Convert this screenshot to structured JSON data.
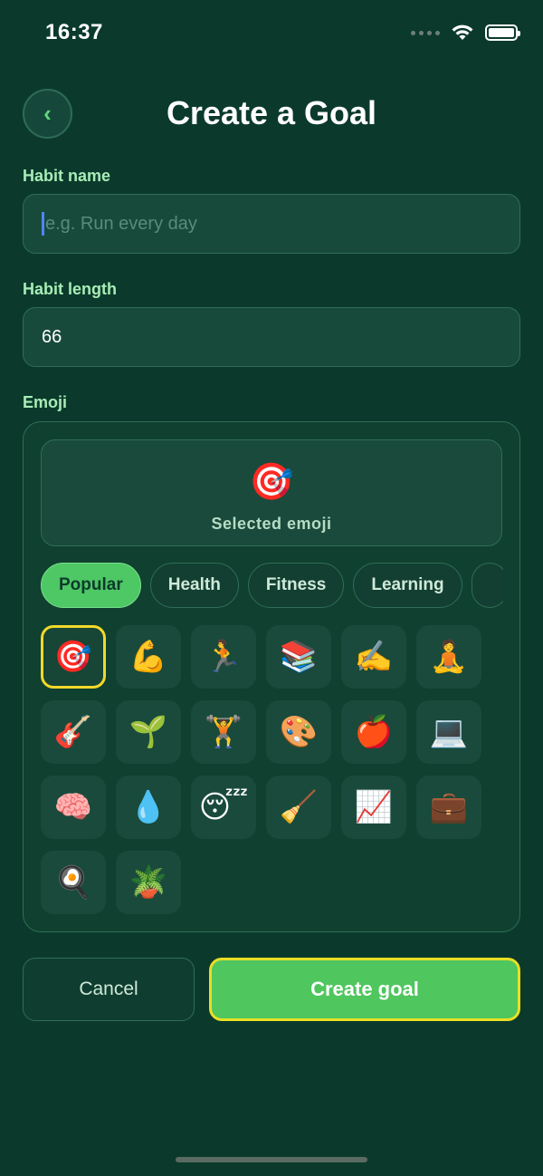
{
  "status_bar": {
    "time": "16:37"
  },
  "header": {
    "title": "Create a Goal",
    "back_glyph": "‹"
  },
  "habit_name": {
    "label": "Habit name",
    "placeholder": "e.g. Run every day",
    "value": ""
  },
  "habit_length": {
    "label": "Habit length",
    "value": "66"
  },
  "emoji": {
    "label": "Emoji",
    "selected_emoji": "🎯",
    "selected_label": "Selected emoji",
    "categories": [
      {
        "label": "Popular",
        "active": true
      },
      {
        "label": "Health",
        "active": false
      },
      {
        "label": "Fitness",
        "active": false
      },
      {
        "label": "Learning",
        "active": false
      },
      {
        "label": "",
        "active": false
      }
    ],
    "items": [
      "🎯",
      "💪",
      "🏃",
      "📚",
      "✍️",
      "🧘",
      "🎸",
      "🌱",
      "🏋️",
      "🎨",
      "🍎",
      "💻",
      "🧠",
      "💧",
      "😴",
      "🧹",
      "📈",
      "💼",
      "🍳",
      "🪴"
    ],
    "selected_index": 0
  },
  "actions": {
    "cancel_label": "Cancel",
    "create_label": "Create goal"
  },
  "colors": {
    "background": "#0b3a2c",
    "accent_green": "#4fc65e",
    "label_green": "#a8ecb6",
    "highlight_yellow": "#e8df25"
  },
  "icons": {
    "back": "chevron-left-icon",
    "wifi": "wifi-icon",
    "battery": "battery-icon",
    "signal": "signal-icon"
  }
}
